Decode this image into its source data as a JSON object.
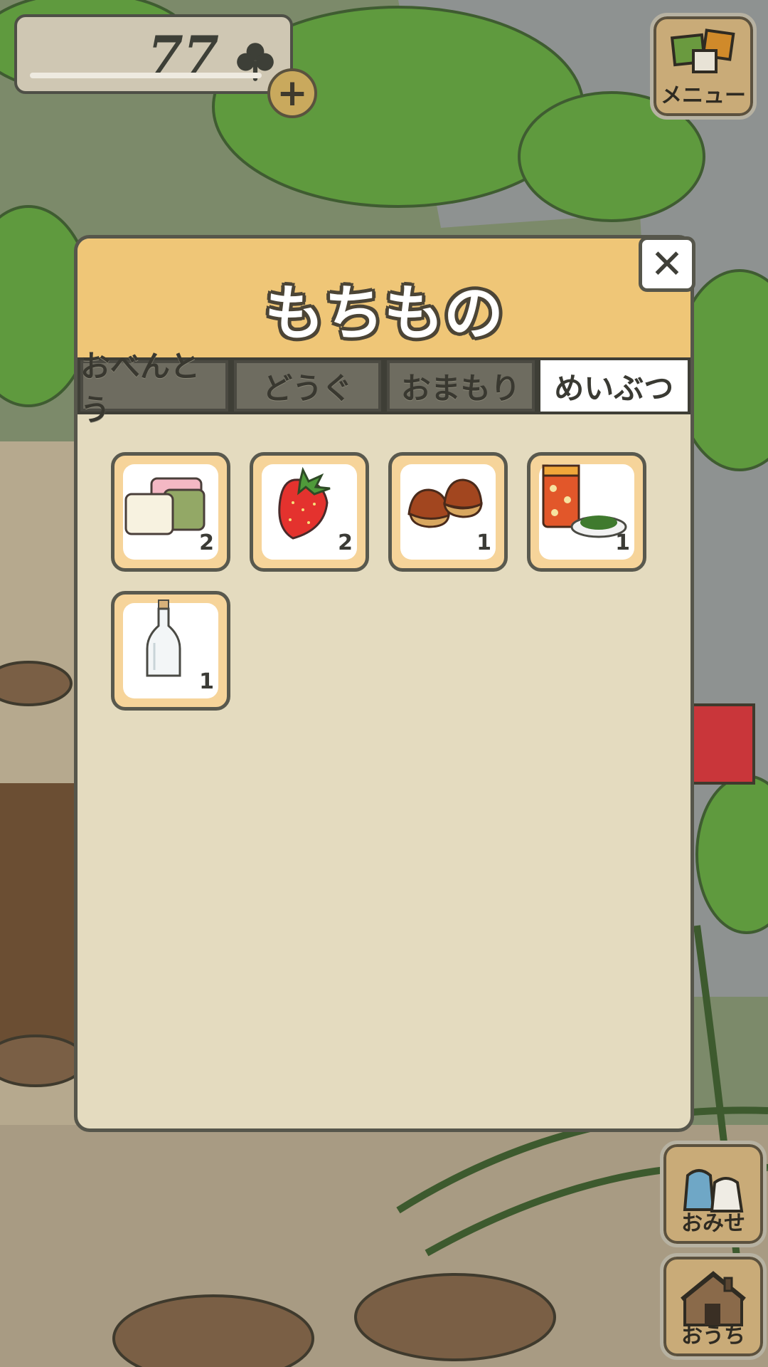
{
  "clover": {
    "count": "77"
  },
  "menu": {
    "menu_label": "メニュー",
    "shop_label": "おみせ",
    "home_label": "おうち"
  },
  "inventory": {
    "title": "もちもの",
    "close_symbol": "✕",
    "tabs": [
      {
        "label": "おべんとう",
        "active": false
      },
      {
        "label": "どうぐ",
        "active": false
      },
      {
        "label": "おまもり",
        "active": false
      },
      {
        "label": "めいぶつ",
        "active": true
      }
    ],
    "items": [
      {
        "icon": "tricolor-mochi-icon",
        "qty": "2"
      },
      {
        "icon": "strawberry-icon",
        "qty": "2"
      },
      {
        "icon": "chestnuts-icon",
        "qty": "1"
      },
      {
        "icon": "tea-canister-icon",
        "qty": "1"
      },
      {
        "icon": "glass-bottle-icon",
        "qty": "1"
      }
    ]
  },
  "colors": {
    "panel_header": "#efc677",
    "panel_body": "#e4dbbf",
    "item_frame": "#f6d49a",
    "outline": "#56564b"
  }
}
